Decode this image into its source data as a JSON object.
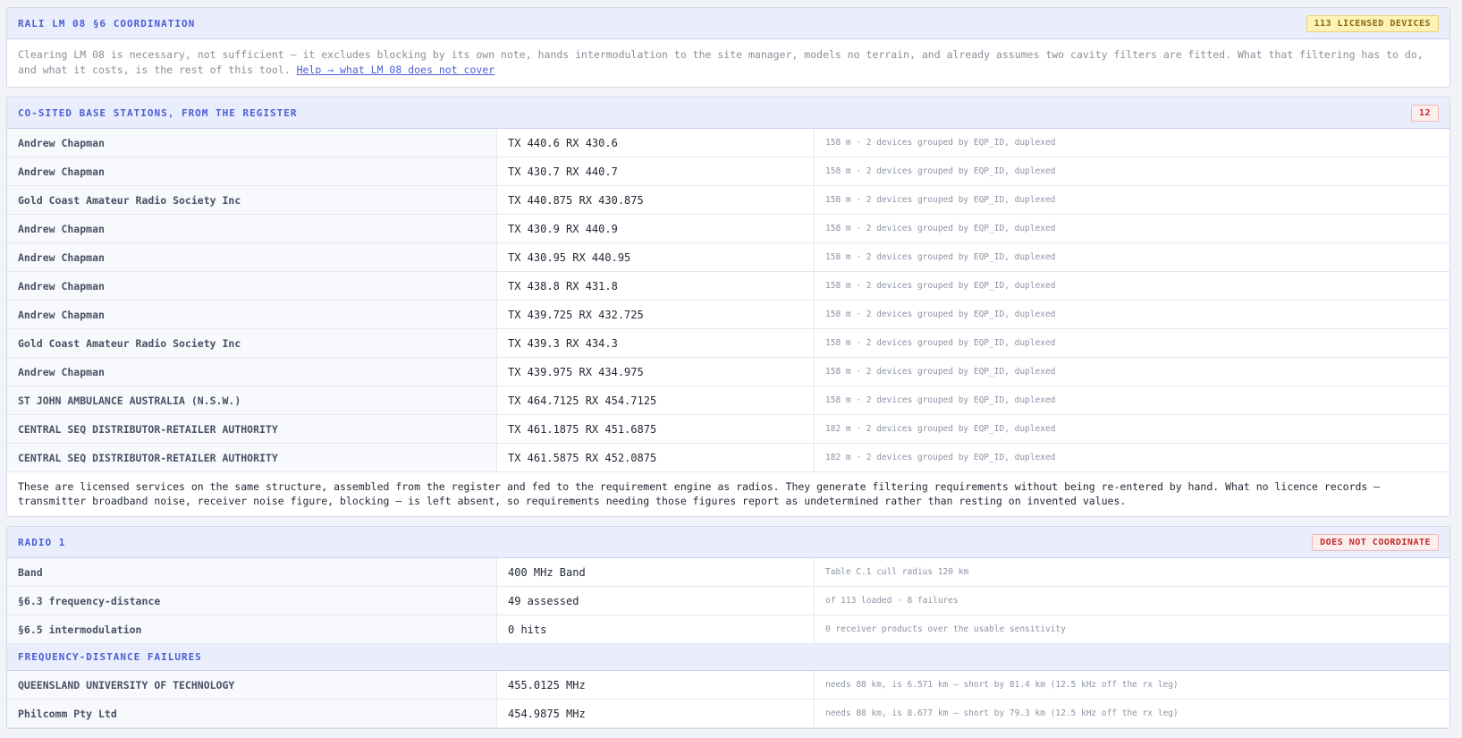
{
  "coordination": {
    "title": "RALI LM 08 §6 COORDINATION",
    "badge": "113 LICENSED DEVICES",
    "intro": "Clearing LM 08 is necessary, not sufficient — it excludes blocking by its own note, hands intermodulation to the site manager, models no terrain, and already assumes two cavity filters are fitted. What that filtering has to do, and what it costs, is the rest of this tool.",
    "help_link": "Help → what LM 08 does not cover"
  },
  "cosited": {
    "title": "CO-SITED BASE STATIONS, FROM THE REGISTER",
    "count": "12",
    "rows": [
      {
        "licensee": "Andrew Chapman",
        "freq": "TX 440.6 RX 430.6",
        "detail": "158 m · 2 devices grouped by EQP_ID, duplexed"
      },
      {
        "licensee": "Andrew Chapman",
        "freq": "TX 430.7 RX 440.7",
        "detail": "158 m · 2 devices grouped by EQP_ID, duplexed"
      },
      {
        "licensee": "Gold Coast Amateur Radio Society Inc",
        "freq": "TX 440.875 RX 430.875",
        "detail": "158 m · 2 devices grouped by EQP_ID, duplexed"
      },
      {
        "licensee": "Andrew Chapman",
        "freq": "TX 430.9 RX 440.9",
        "detail": "158 m · 2 devices grouped by EQP_ID, duplexed"
      },
      {
        "licensee": "Andrew Chapman",
        "freq": "TX 430.95 RX 440.95",
        "detail": "158 m · 2 devices grouped by EQP_ID, duplexed"
      },
      {
        "licensee": "Andrew Chapman",
        "freq": "TX 438.8 RX 431.8",
        "detail": "158 m · 2 devices grouped by EQP_ID, duplexed"
      },
      {
        "licensee": "Andrew Chapman",
        "freq": "TX 439.725 RX 432.725",
        "detail": "158 m · 2 devices grouped by EQP_ID, duplexed"
      },
      {
        "licensee": "Gold Coast Amateur Radio Society Inc",
        "freq": "TX 439.3 RX 434.3",
        "detail": "158 m · 2 devices grouped by EQP_ID, duplexed"
      },
      {
        "licensee": "Andrew Chapman",
        "freq": "TX 439.975 RX 434.975",
        "detail": "158 m · 2 devices grouped by EQP_ID, duplexed"
      },
      {
        "licensee": "ST JOHN AMBULANCE AUSTRALIA (N.S.W.)",
        "freq": "TX 464.7125 RX 454.7125",
        "detail": "158 m · 2 devices grouped by EQP_ID, duplexed"
      },
      {
        "licensee": "CENTRAL SEQ DISTRIBUTOR-RETAILER AUTHORITY",
        "freq": "TX 461.1875 RX 451.6875",
        "detail": "182 m · 2 devices grouped by EQP_ID, duplexed"
      },
      {
        "licensee": "CENTRAL SEQ DISTRIBUTOR-RETAILER AUTHORITY",
        "freq": "TX 461.5875 RX 452.0875",
        "detail": "182 m · 2 devices grouped by EQP_ID, duplexed"
      }
    ],
    "note": "These are licensed services on the same structure, assembled from the register and fed to the requirement engine as radios. They generate filtering requirements without being re-entered by hand. What no licence records — transmitter broadband noise, receiver noise figure, blocking — is left absent, so requirements needing those figures report as undetermined rather than resting on invented values."
  },
  "radio": {
    "title": "RADIO 1",
    "badge": "DOES NOT COORDINATE",
    "rows": [
      {
        "label": "Band",
        "value": "400 MHz Band",
        "detail": "Table C.1 cull radius 120 km"
      },
      {
        "label": "§6.3 frequency-distance",
        "value": "49 assessed",
        "detail": "of 113 loaded · 8 failures"
      },
      {
        "label": "§6.5 intermodulation",
        "value": "0 hits",
        "detail": "0 receiver products over the usable sensitivity"
      }
    ],
    "failures_title": "FREQUENCY-DISTANCE FAILURES",
    "failures": [
      {
        "licensee": "QUEENSLAND UNIVERSITY OF TECHNOLOGY",
        "freq": "455.0125 MHz",
        "detail": "needs 88 km, is 6.571 km — short by 81.4 km (12.5 kHz off the rx leg)"
      },
      {
        "licensee": "Philcomm Pty Ltd",
        "freq": "454.9875 MHz",
        "detail": "needs 88 km, is 8.677 km — short by 79.3 km (12.5 kHz off the rx leg)"
      }
    ]
  },
  "colors": {
    "accent": "#4a5fd6",
    "warn": "#fdf3b8",
    "fail": "#c22a2a"
  }
}
